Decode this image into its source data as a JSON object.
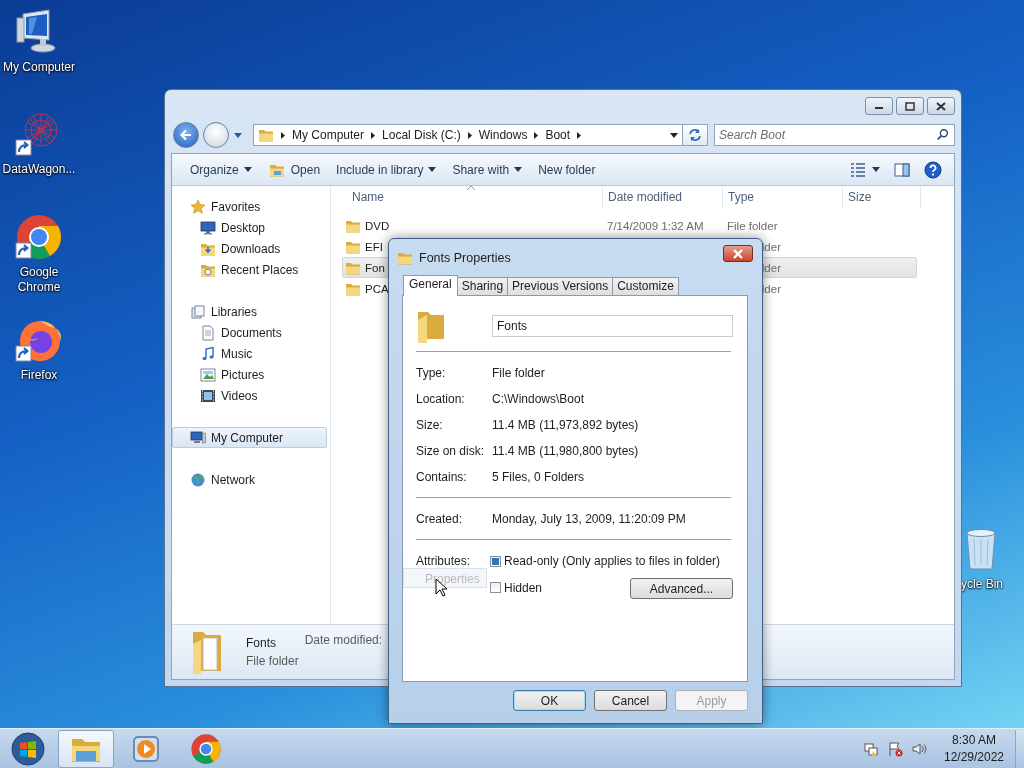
{
  "desktop_icons": [
    {
      "label": "My Computer",
      "kind": "computer"
    },
    {
      "label": "DataWagon...",
      "kind": "datawagon"
    },
    {
      "label": "Google Chrome",
      "kind": "chrome"
    },
    {
      "label": "Firefox",
      "kind": "firefox"
    },
    {
      "label": "ycle Bin",
      "kind": "recycle"
    }
  ],
  "explorer": {
    "address": [
      "My Computer",
      "Local Disk (C:)",
      "Windows",
      "Boot"
    ],
    "search": {
      "placeholder": "Search Boot"
    },
    "toolbar": [
      {
        "label": "Organize",
        "kind": "menu"
      },
      {
        "label": "Open",
        "kind": "open"
      },
      {
        "label": "Include in library",
        "kind": "menu"
      },
      {
        "label": "Share with",
        "kind": "menu"
      },
      {
        "label": "New folder",
        "kind": "plain"
      }
    ],
    "sidebar": [
      {
        "label": "Favorites",
        "kind": "favorites",
        "selected": false,
        "children": [
          {
            "label": "Desktop",
            "kind": "desktop",
            "selected": false
          },
          {
            "label": "Downloads",
            "kind": "downloads",
            "selected": false
          },
          {
            "label": "Recent Places",
            "kind": "recent",
            "selected": false
          }
        ]
      },
      {
        "label": "Libraries",
        "kind": "libraries",
        "selected": false,
        "children": [
          {
            "label": "Documents",
            "kind": "documents",
            "selected": false
          },
          {
            "label": "Music",
            "kind": "music",
            "selected": false
          },
          {
            "label": "Pictures",
            "kind": "pictures",
            "selected": false
          },
          {
            "label": "Videos",
            "kind": "videos",
            "selected": false
          }
        ]
      },
      {
        "label": "My Computer",
        "kind": "computer",
        "selected": true
      },
      {
        "label": "Network",
        "kind": "network",
        "selected": false
      }
    ],
    "columns": [
      "Name",
      "Date modified",
      "Type",
      "Size"
    ],
    "rows": [
      {
        "name": "DVD",
        "date": "7/14/2009 1:32 AM",
        "type": "File folder",
        "selected": false
      },
      {
        "name": "EFI",
        "type": "lder",
        "selected": false
      },
      {
        "name": "Fon",
        "type": "lder",
        "selected": true
      },
      {
        "name": "PCA",
        "type": "lder",
        "selected": false
      }
    ],
    "details": {
      "name": "Fonts",
      "type": "File folder",
      "field": "Date modified:"
    }
  },
  "dialog": {
    "title": "Fonts Properties",
    "tabs": [
      {
        "label": "General",
        "selected": true
      },
      {
        "label": "Sharing",
        "selected": false
      },
      {
        "label": "Previous Versions",
        "selected": false
      },
      {
        "label": "Customize",
        "selected": false
      }
    ],
    "name_value": "Fonts",
    "sections": [
      [
        {
          "label": "Type:",
          "value": "File folder"
        },
        {
          "label": "Location:",
          "value": "C:\\Windows\\Boot"
        },
        {
          "label": "Size:",
          "value": "11.4 MB (11,973,892 bytes)"
        },
        {
          "label": "Size on disk:",
          "value": "11.4 MB (11,980,800 bytes)"
        },
        {
          "label": "Contains:",
          "value": "5 Files, 0 Folders"
        }
      ],
      [
        {
          "label": "Created:",
          "value": "Monday, July 13, 2009, 11:20:09 PM"
        }
      ]
    ],
    "attributes": {
      "label": "Attributes:",
      "options": [
        {
          "label": "Read-only (Only applies to files in folder)",
          "checked": true
        },
        {
          "label": "Hidden",
          "checked": false
        }
      ],
      "button": "Advanced..."
    },
    "drag_ghost": "Properties",
    "buttons": [
      {
        "label": "OK",
        "default": true,
        "disabled": false
      },
      {
        "label": "Cancel",
        "default": false,
        "disabled": false
      },
      {
        "label": "Apply",
        "default": false,
        "disabled": true
      }
    ]
  },
  "taskbar": {
    "apps": [
      {
        "kind": "explorer",
        "selected": true
      },
      {
        "kind": "media",
        "selected": false
      },
      {
        "kind": "chrome",
        "selected": false
      }
    ],
    "time": "8:30 AM",
    "date": "12/29/2022"
  }
}
